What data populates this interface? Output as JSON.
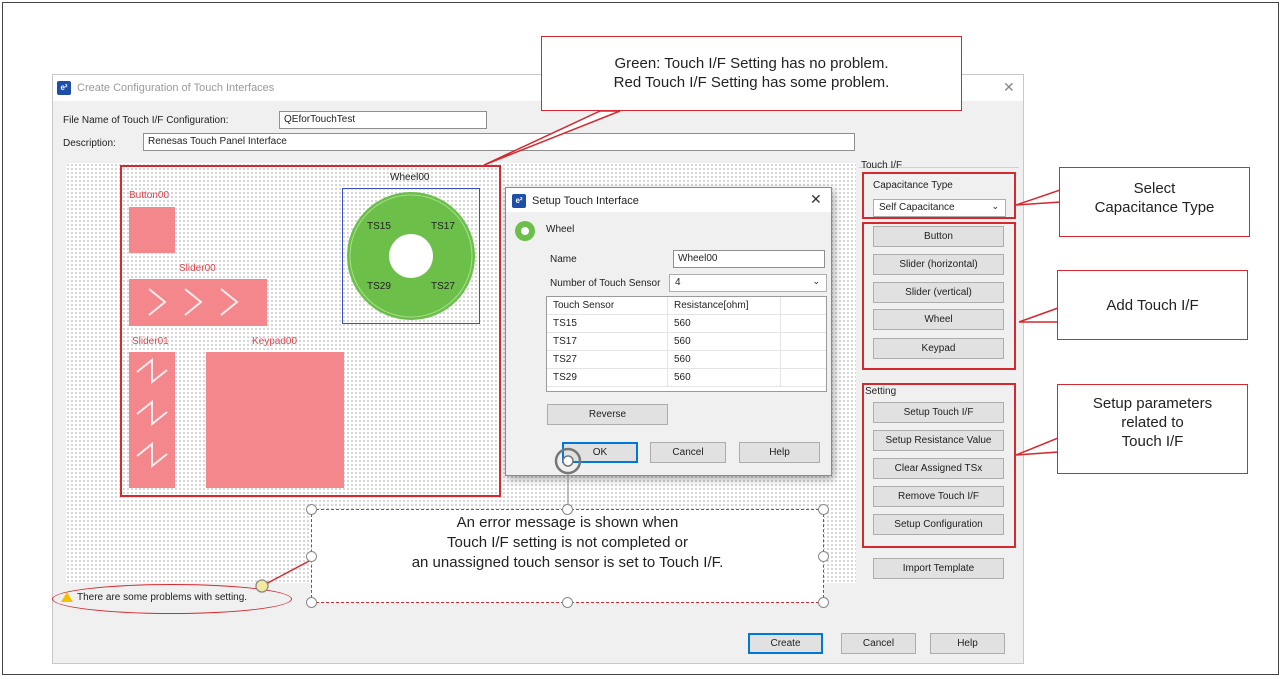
{
  "main": {
    "title": "Create Configuration of Touch Interfaces",
    "app_icon": "e²",
    "file_name_label": "File Name of Touch I/F Configuration:",
    "file_name_value": "QEforTouchTest",
    "description_label": "Description:",
    "description_value": "Renesas Touch Panel Interface",
    "status": "There are some problems with setting.",
    "buttons": {
      "create": "Create",
      "cancel": "Cancel",
      "help": "Help"
    }
  },
  "canvas": {
    "button00": "Button00",
    "slider00": "Slider00",
    "slider01": "Slider01",
    "keypad00": "Keypad00",
    "wheel00": "Wheel00",
    "wheel_sensors": [
      "TS15",
      "TS17",
      "TS29",
      "TS27"
    ]
  },
  "touch_if": {
    "group_label": "Touch I/F",
    "cap_label": "Capacitance Type",
    "cap_value": "Self Capacitance",
    "buttons": [
      "Button",
      "Slider (horizontal)",
      "Slider (vertical)",
      "Wheel",
      "Keypad"
    ]
  },
  "setting": {
    "group_label": "Setting",
    "buttons": [
      "Setup Touch I/F",
      "Setup Resistance Value",
      "Clear Assigned TSx",
      "Remove Touch I/F",
      "Setup Configuration"
    ],
    "import_template": "Import Template"
  },
  "setup_dialog": {
    "title": "Setup Touch Interface",
    "type": "Wheel",
    "name_label": "Name",
    "name_value": "Wheel00",
    "num_label": "Number of Touch Sensor",
    "num_value": "4",
    "columns": [
      "Touch Sensor",
      "Resistance[ohm]"
    ],
    "rows": [
      [
        "TS15",
        "560"
      ],
      [
        "TS17",
        "560"
      ],
      [
        "TS27",
        "560"
      ],
      [
        "TS29",
        "560"
      ]
    ],
    "reverse": "Reverse",
    "ok": "OK",
    "cancel": "Cancel",
    "help": "Help"
  },
  "callouts": {
    "status_colors": [
      "Green: Touch I/F Setting has no problem.",
      "Red  Touch I/F Setting has some problem."
    ],
    "capacitance": [
      "Select",
      "Capacitance Type"
    ],
    "add": [
      "Add Touch I/F"
    ],
    "setup": [
      "Setup parameters",
      "related to",
      "Touch I/F"
    ],
    "error": [
      "An error message is shown when",
      "Touch I/F setting is not completed or",
      "an unassigned touch sensor is set to Touch I/F."
    ]
  },
  "colors": {
    "error_red": "#d3292f",
    "wheel_green": "#6cc04a",
    "pink": "#f4878c",
    "accent_blue": "#0078d7"
  }
}
